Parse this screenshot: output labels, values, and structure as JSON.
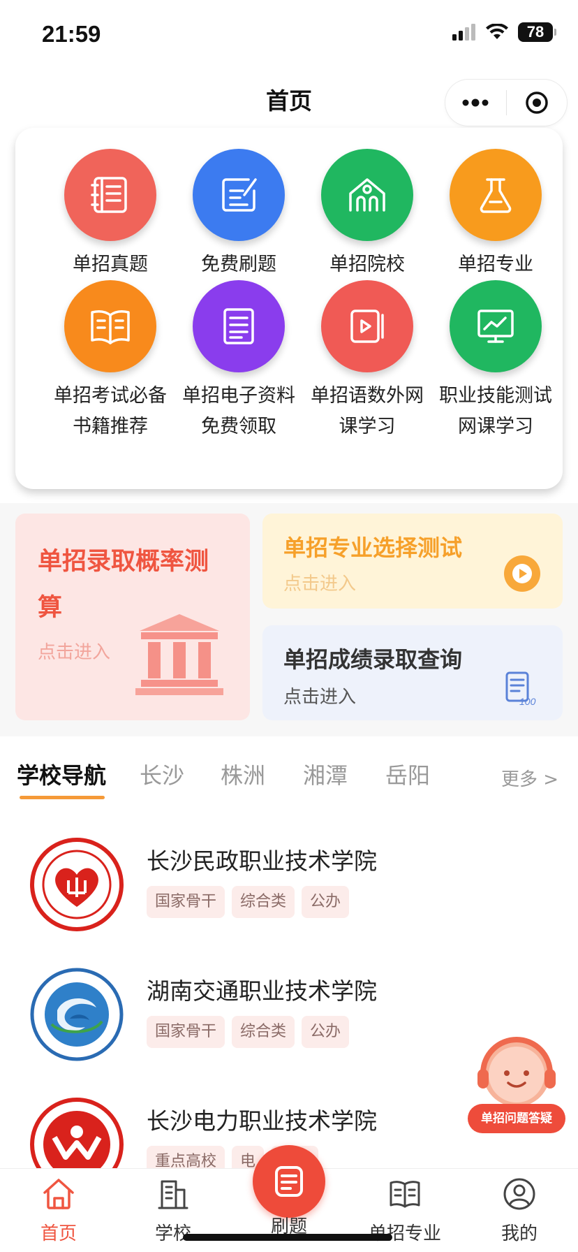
{
  "status": {
    "time": "21:59",
    "battery": "78"
  },
  "nav": {
    "title": "首页"
  },
  "grid": [
    {
      "label": "单招真题",
      "color": "#f0645a",
      "icon": "book-stack-icon"
    },
    {
      "label": "免费刷题",
      "color": "#3c7bf0",
      "icon": "edit-note-icon"
    },
    {
      "label": "单招院校",
      "color": "#20b760",
      "icon": "school-building-icon"
    },
    {
      "label": "单招专业",
      "color": "#f89b1d",
      "icon": "flask-icon"
    },
    {
      "label": "单招考试必备书籍推荐",
      "color": "#f88a1c",
      "icon": "open-book-icon"
    },
    {
      "label": "单招电子资料免费领取",
      "color": "#8a3ded",
      "icon": "document-icon"
    },
    {
      "label": "单招语数外网课学习",
      "color": "#f05a55",
      "icon": "video-play-icon"
    },
    {
      "label": "职业技能测试网课学习",
      "color": "#20b760",
      "icon": "monitor-chart-icon"
    }
  ],
  "features": {
    "probability": {
      "title": "单招录取概率测算",
      "sub": "点击进入"
    },
    "major_test": {
      "title": "单招专业选择测试",
      "sub": "点击进入"
    },
    "score_query": {
      "title": "单招成绩录取查询",
      "sub": "点击进入"
    }
  },
  "school_nav": {
    "tabs": [
      "学校导航",
      "长沙",
      "株洲",
      "湘潭",
      "岳阳"
    ],
    "more": "更多 >"
  },
  "schools": [
    {
      "name": "长沙民政职业技术学院",
      "tags": [
        "国家骨干",
        "综合类",
        "公办"
      ]
    },
    {
      "name": "湖南交通职业技术学院",
      "tags": [
        "国家骨干",
        "综合类",
        "公办"
      ]
    },
    {
      "name": "长沙电力职业技术学院",
      "tags": [
        "重点高校",
        "电",
        "公办"
      ]
    }
  ],
  "helper": {
    "label": "单招问题答疑"
  },
  "tabbar": [
    {
      "label": "首页"
    },
    {
      "label": "学校"
    },
    {
      "label": "刷题"
    },
    {
      "label": "单招专业"
    },
    {
      "label": "我的"
    }
  ]
}
